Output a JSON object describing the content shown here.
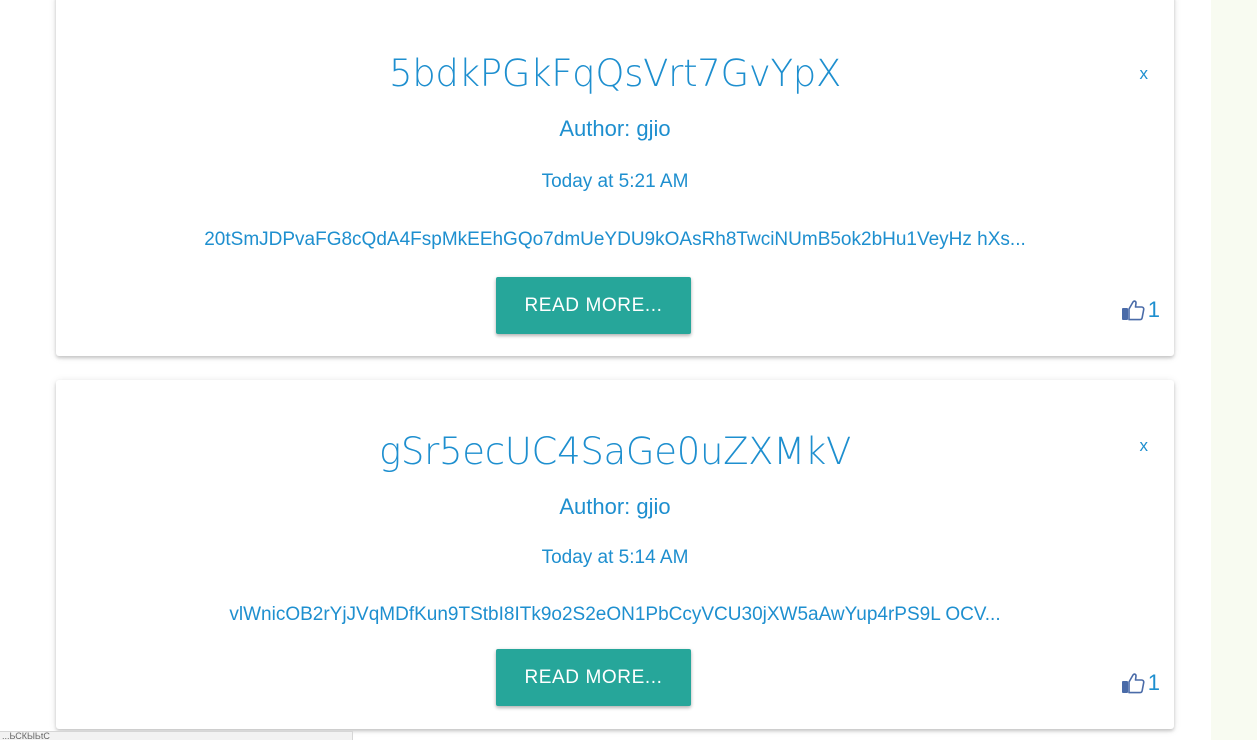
{
  "posts": [
    {
      "title": "5bdkPGkFqQsVrt7GvYpX",
      "author": "Author: gjio",
      "date": "Today at 5:21 AM",
      "excerpt": "20tSmJDPvaFG8cQdA4FspMkEEhGQo7dmUeYDU9kOAsRh8TwciNUmB5ok2bHu1VeyHz hXs...",
      "close_label": "x",
      "read_more_label": "READ MORE...",
      "like_icon": "thumbs-up-icon",
      "likes": "1"
    },
    {
      "title": "gSr5ecUC4SaGe0uZXMkV",
      "author": "Author: gjio",
      "date": "Today at 5:14 AM",
      "excerpt": "vlWnicOB2rYjJVqMDfKun9TStbI8ITk9o2S2eON1PbCcyVCU30jXW5aAwYup4rPS9L OCV...",
      "close_label": "x",
      "read_more_label": "READ MORE...",
      "like_icon": "thumbs-up-icon",
      "likes": "1"
    }
  ],
  "status_bar": {
    "text": "...ЬСКЫЬtC"
  },
  "colors": {
    "accent_text": "#1e8fcf",
    "button": "#26a69a",
    "page_bg": "#f8fbf1"
  }
}
